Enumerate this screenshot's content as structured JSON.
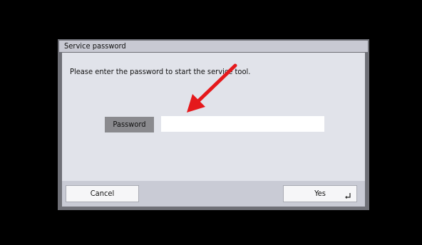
{
  "dialog": {
    "title": "Service password",
    "message": "Please enter the password to start the service tool.",
    "password_label": "Password",
    "password_value": "",
    "cancel_label": "Cancel",
    "yes_label": "Yes"
  },
  "colors": {
    "background": "#000000",
    "dialog_frame": "#6f7077",
    "titlebar": "#c8c9d3",
    "body": "#e1e3ea",
    "footer": "#c9cbd5",
    "annotation_arrow": "#e5191c"
  },
  "icons": {
    "yes_button_corner": "enter-icon",
    "annotation": "red-arrow-icon"
  }
}
